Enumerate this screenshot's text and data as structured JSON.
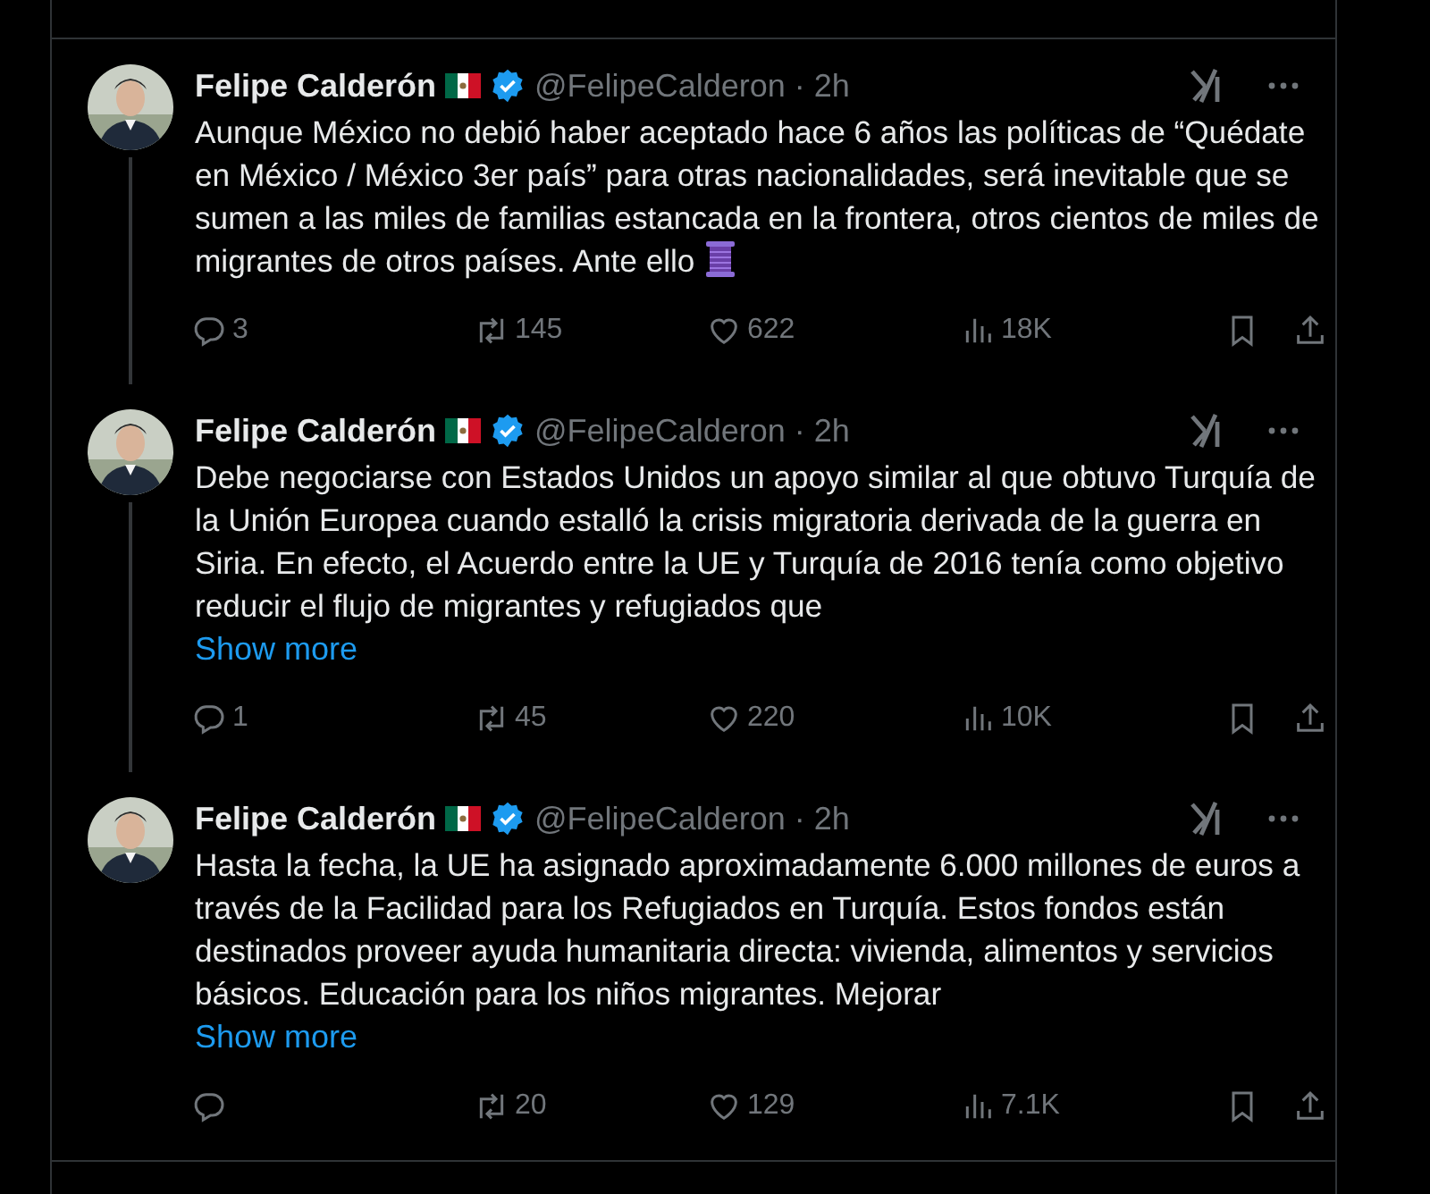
{
  "tweets": [
    {
      "author": "Felipe Calderón",
      "verified": true,
      "handle": "@FelipeCalderon",
      "separator": "·",
      "time": "2h",
      "thread_line": true,
      "text": "Aunque México no debió haber aceptado hace 6 años las políticas de “Quédate en México / México 3er país” para otras nacionalidades, será inevitable que se sumen a las miles de familias estancada en la frontera, otros cientos de miles de migrantes de otros países.  Ante ello",
      "thread_emoji": true,
      "replies": "3",
      "reposts": "145",
      "likes": "622",
      "views": "18K"
    },
    {
      "author": "Felipe Calderón",
      "verified": true,
      "handle": "@FelipeCalderon",
      "separator": "·",
      "time": "2h",
      "thread_line": true,
      "text": "Debe negociarse con Estados Unidos un apoyo similar al que obtuvo Turquía de la Unión Europea cuando estalló la crisis migratoria derivada de la guerra en Siria. En efecto, el Acuerdo entre la UE y Turquía de 2016 tenía como objetivo reducir el flujo de migrantes y refugiados que",
      "show_more": "Show more",
      "replies": "1",
      "reposts": "45",
      "likes": "220",
      "views": "10K"
    },
    {
      "author": "Felipe Calderón",
      "verified": true,
      "handle": "@FelipeCalderon",
      "separator": "·",
      "time": "2h",
      "thread_line": false,
      "text": "Hasta la fecha, la UE ha asignado aproximadamente 6.000 millones de euros a través de la Facilidad para los Refugiados en Turquía. Estos fondos están destinados proveer ayuda humanitaria directa: vivienda, alimentos y servicios básicos. Educación para los niños migrantes. Mejorar",
      "show_more": "Show more",
      "reposts": "20",
      "likes": "129",
      "views": "7.1K"
    }
  ]
}
